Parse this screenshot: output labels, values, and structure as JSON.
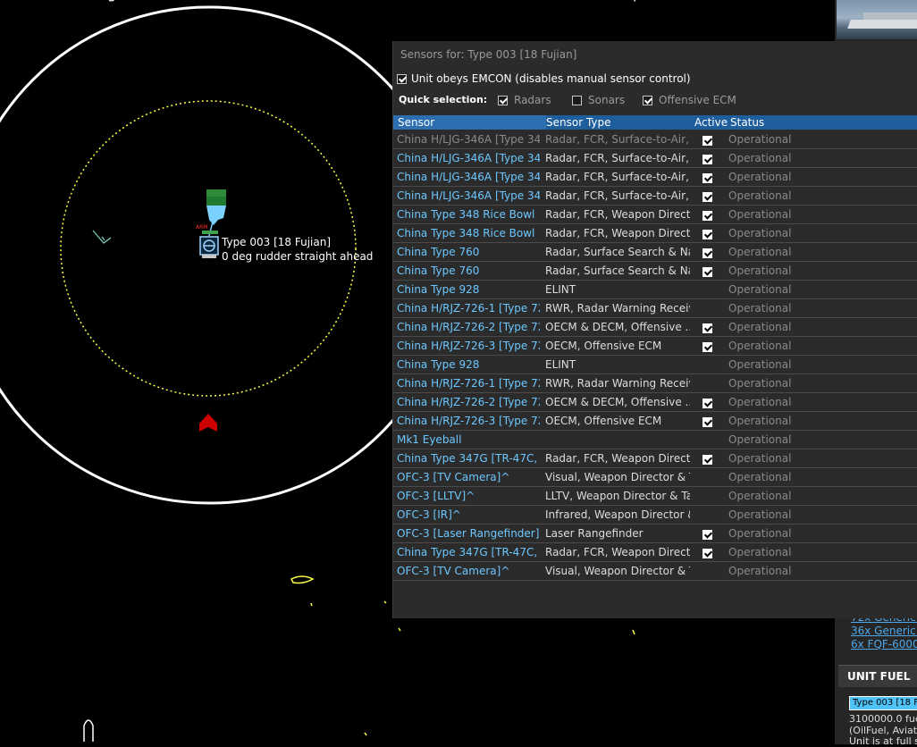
{
  "map": {
    "unit_name": "Type 003 [18 Fujian]",
    "unit_status": "0 deg  rudder straight ahead"
  },
  "dialog": {
    "title": "Sensors for: Type 003 [18 Fujian]",
    "emcon_label": "Unit obeys EMCON (disables manual sensor control)",
    "emcon_checked": true,
    "quick_selection_label": "Quick selection:",
    "quick": [
      {
        "label": "Radars",
        "checked": true
      },
      {
        "label": "Sonars",
        "checked": false
      },
      {
        "label": "Offensive ECM",
        "checked": true
      }
    ],
    "columns": {
      "sensor": "Sensor",
      "type": "Sensor Type",
      "active": "Active",
      "status": "Status"
    },
    "rows": [
      {
        "sensor": "China H/LJG-346A [Type 346...",
        "type": "Radar, FCR, Surface-to-Air, ...",
        "active": true,
        "status": "Operational"
      },
      {
        "sensor": "China H/LJG-346A [Type 346...",
        "type": "Radar, FCR, Surface-to-Air, ...",
        "active": true,
        "status": "Operational"
      },
      {
        "sensor": "China H/LJG-346A [Type 346...",
        "type": "Radar, FCR, Surface-to-Air, ...",
        "active": true,
        "status": "Operational"
      },
      {
        "sensor": "China H/LJG-346A [Type 346...",
        "type": "Radar, FCR, Surface-to-Air, ...",
        "active": true,
        "status": "Operational"
      },
      {
        "sensor": "China Type 348 Rice Bowl",
        "type": "Radar, FCR, Weapon Director",
        "active": true,
        "status": "Operational"
      },
      {
        "sensor": "China Type 348 Rice Bowl",
        "type": "Radar, FCR, Weapon Director",
        "active": true,
        "status": "Operational"
      },
      {
        "sensor": "China Type 760",
        "type": "Radar, Surface Search & Na...",
        "active": true,
        "status": "Operational"
      },
      {
        "sensor": "China Type 760",
        "type": "Radar, Surface Search & Na...",
        "active": true,
        "status": "Operational"
      },
      {
        "sensor": "China Type 928",
        "type": "ELINT",
        "active": null,
        "status": "Operational"
      },
      {
        "sensor": "China H/RJZ-726-1 [Type 72...",
        "type": "RWR, Radar Warning Receiver",
        "active": null,
        "status": "Operational"
      },
      {
        "sensor": "China H/RJZ-726-2 [Type 72...",
        "type": "OECM & DECM, Offensive ...",
        "active": true,
        "status": "Operational"
      },
      {
        "sensor": "China H/RJZ-726-3 [Type 72...",
        "type": "OECM, Offensive ECM",
        "active": true,
        "status": "Operational"
      },
      {
        "sensor": "China Type 928",
        "type": "ELINT",
        "active": null,
        "status": "Operational"
      },
      {
        "sensor": "China H/RJZ-726-1 [Type 72...",
        "type": "RWR, Radar Warning Receiver",
        "active": null,
        "status": "Operational"
      },
      {
        "sensor": "China H/RJZ-726-2 [Type 72...",
        "type": "OECM & DECM, Offensive ...",
        "active": true,
        "status": "Operational"
      },
      {
        "sensor": "China H/RJZ-726-3 [Type 72...",
        "type": "OECM, Offensive ECM",
        "active": true,
        "status": "Operational"
      },
      {
        "sensor": "Mk1 Eyeball",
        "type": "",
        "active": null,
        "status": "Operational"
      },
      {
        "sensor": "China Type 347G [TR-47C, R...",
        "type": "Radar, FCR, Weapon Director",
        "active": true,
        "status": "Operational"
      },
      {
        "sensor": "OFC-3 [TV Camera]^",
        "type": "Visual, Weapon Director & T...",
        "active": null,
        "status": "Operational"
      },
      {
        "sensor": "OFC-3 [LLTV]^",
        "type": "LLTV, Weapon Director & Ta...",
        "active": null,
        "status": "Operational"
      },
      {
        "sensor": "OFC-3 [IR]^",
        "type": "Infrared, Weapon Director &...",
        "active": null,
        "status": "Operational"
      },
      {
        "sensor": "OFC-3 [Laser Rangefinder]^",
        "type": "Laser Rangefinder",
        "active": true,
        "status": "Operational"
      },
      {
        "sensor": "China Type 347G [TR-47C, R...",
        "type": "Radar, FCR, Weapon Director",
        "active": true,
        "status": "Operational"
      },
      {
        "sensor": "OFC-3 [TV Camera]^",
        "type": "Visual, Weapon Director & T...",
        "active": null,
        "status": "Operational"
      }
    ]
  },
  "side_panel": {
    "loadout": [
      "72x Generic Gr",
      "36x Generic Fla",
      "6x FQF-6000 A"
    ],
    "fuel_header": "UNIT FUEL",
    "fuel_select": "Type 003 [18 Fuj",
    "fuel_lines": [
      "3100000.0 fuel C",
      "(OilFuel, Aviatio",
      "Unit is at full sto"
    ]
  },
  "colors": {
    "map_bg": "#000000",
    "range_ring": "#ffffff",
    "dashed_ring": "#ffff00",
    "hostile": "#cc0000",
    "header_blue": "#1f5e9c"
  }
}
